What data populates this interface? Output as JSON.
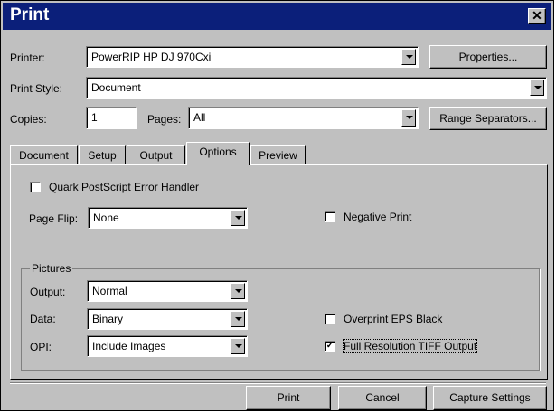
{
  "window": {
    "title": "Print"
  },
  "printer": {
    "label": "Printer:",
    "value": "PowerRIP HP DJ 970Cxi",
    "properties_button": "Properties..."
  },
  "print_style": {
    "label": "Print Style:",
    "value": "Document"
  },
  "copies": {
    "label": "Copies:",
    "value": "1"
  },
  "pages": {
    "label": "Pages:",
    "value": "All",
    "range_button": "Range Separators..."
  },
  "tabs": [
    {
      "label": "Document",
      "active": false
    },
    {
      "label": "Setup",
      "active": false
    },
    {
      "label": "Output",
      "active": false
    },
    {
      "label": "Options",
      "active": true
    },
    {
      "label": "Preview",
      "active": false
    }
  ],
  "options": {
    "quark_error_handler": {
      "label": "Quark PostScript Error Handler",
      "checked": false
    },
    "page_flip": {
      "label": "Page Flip:",
      "value": "None"
    },
    "negative_print": {
      "label": "Negative Print",
      "checked": false
    }
  },
  "pictures": {
    "group_label": "Pictures",
    "output": {
      "label": "Output:",
      "value": "Normal"
    },
    "data": {
      "label": "Data:",
      "value": "Binary"
    },
    "opi": {
      "label": "OPI:",
      "value": "Include Images"
    },
    "overprint_eps_black": {
      "label": "Overprint EPS Black",
      "checked": false
    },
    "full_res_tiff": {
      "label": "Full Resolution TIFF Output",
      "checked": true
    }
  },
  "buttons": {
    "print": "Print",
    "cancel": "Cancel",
    "capture": "Capture Settings"
  },
  "icons": {
    "close": "close-icon",
    "dropdown": "chevron-down-icon",
    "check": "checkmark-icon"
  }
}
